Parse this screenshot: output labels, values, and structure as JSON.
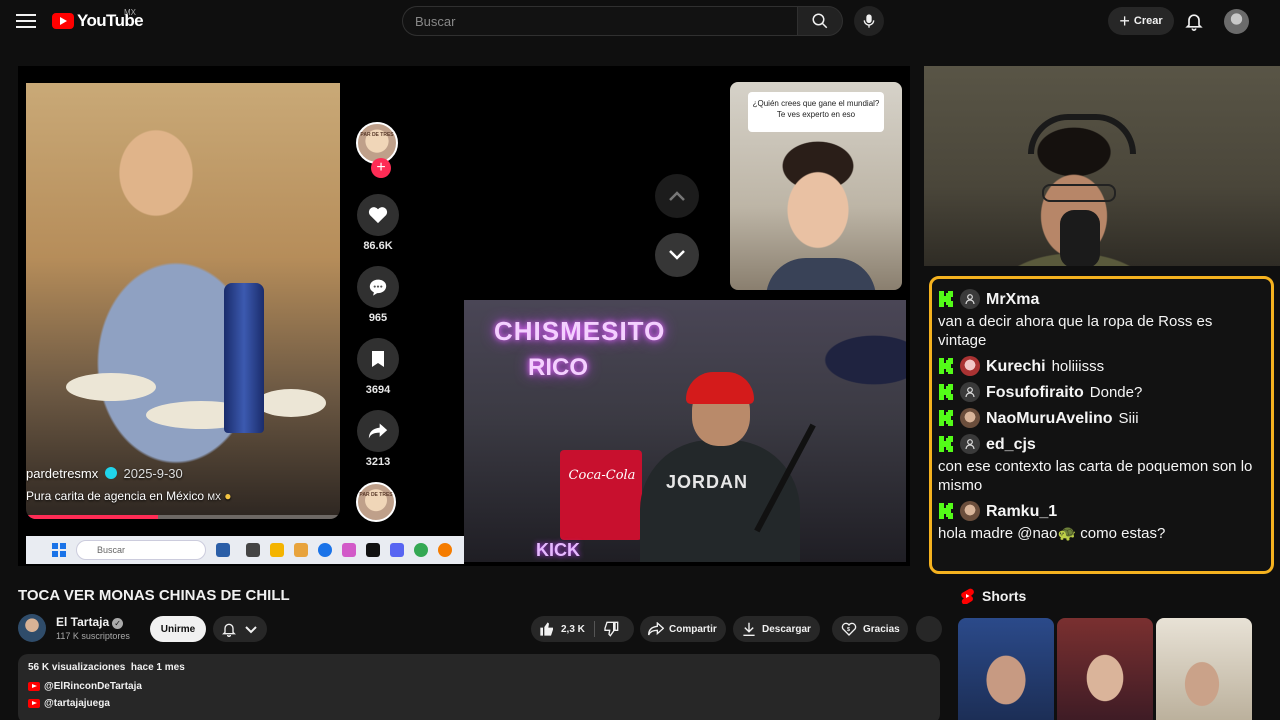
{
  "app": {
    "name": "YouTube",
    "country": "MX"
  },
  "search": {
    "placeholder": "Buscar"
  },
  "header": {
    "create_label": "Crear"
  },
  "player": {
    "tiktok": {
      "handle": "pardetresmx",
      "date": "2025-9-30",
      "caption": "Pura carita de agencia en México",
      "caption_flag": "MX",
      "progress": 0.42,
      "likes": "86.6K",
      "comments": "965",
      "saves": "3694",
      "shares": "3213",
      "avatar_label": "PAR DE TRES",
      "question_card": "¿Quién crees que gane el mundial? Te ves experto en eso"
    },
    "neon_sign": {
      "line1": "CHISMESITO",
      "line2": "RICO"
    },
    "cam_labels": {
      "cocacola": "Coca-Cola",
      "shirt": "JORDAN",
      "corner": "KICK"
    },
    "taskbar": {
      "search_label": "Buscar"
    }
  },
  "chat": {
    "accent": "#f5b21f",
    "kick_green": "#53fc18",
    "messages": [
      {
        "user": "MrXma",
        "text": "van a decir ahora que la ropa de Ross es vintage",
        "inline": false,
        "avatar": "user-icon"
      },
      {
        "user": "Kurechi",
        "text": "holiiisss",
        "inline": true,
        "avatar": "anime-avatar"
      },
      {
        "user": "Fosufofiraito",
        "text": "Donde?",
        "inline": true,
        "avatar": "user-icon"
      },
      {
        "user": "NaoMuruAvelino",
        "text": "Siii",
        "inline": true,
        "avatar": "photo-avatar"
      },
      {
        "user": "ed_cjs",
        "text": "con ese contexto las carta de poquemon son lo mismo",
        "inline": false,
        "avatar": "user-icon"
      },
      {
        "user": "Ramku_1",
        "text": "hola madre @nao🐢 como estas?",
        "inline": false,
        "avatar": "photo-avatar"
      }
    ]
  },
  "video": {
    "title": "TOCA VER MONAS CHINAS DE CHILL",
    "channel": "El Tartaja",
    "subscribers": "117 K suscriptores",
    "join_label": "Unirme",
    "likes": "2,3 K",
    "share_label": "Compartir",
    "download_label": "Descargar",
    "thanks_label": "Gracias",
    "views": "56 K visualizaciones",
    "age": "hace 1 mes",
    "links": [
      "@ElRinconDeTartaja",
      "@tartajajuega"
    ]
  },
  "shorts": {
    "title": "Shorts",
    "count": 3
  }
}
